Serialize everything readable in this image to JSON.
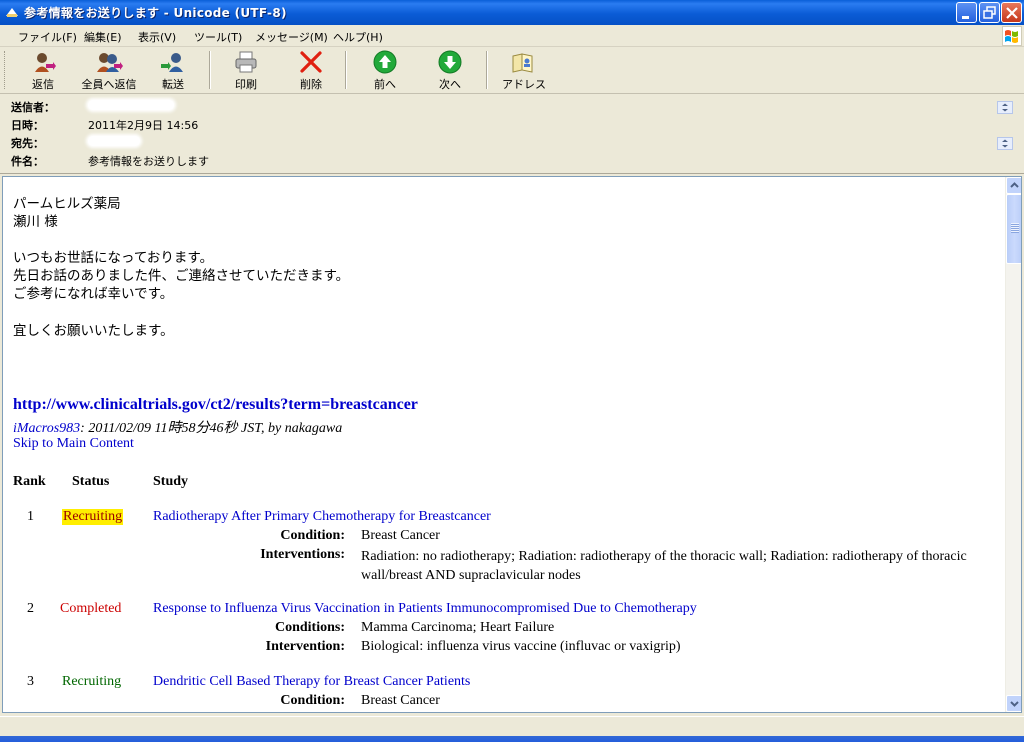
{
  "window": {
    "title": "参考情報をお送りします - Unicode (UTF-8)",
    "controls": [
      "minimize",
      "maximize",
      "close"
    ]
  },
  "menu": [
    {
      "label": "ファイル(F)"
    },
    {
      "label": "編集(E)"
    },
    {
      "label": "表示(V)"
    },
    {
      "label": "ツール(T)"
    },
    {
      "label": "メッセージ(M)"
    },
    {
      "label": "ヘルプ(H)"
    }
  ],
  "toolbar": {
    "reply": "返信",
    "reply_all": "全員へ返信",
    "forward": "転送",
    "print": "印刷",
    "delete": "削除",
    "previous": "前へ",
    "next": "次へ",
    "addresses": "アドレス"
  },
  "header": {
    "from_label": "送信者：",
    "date_label": "日時：",
    "date_value": "2011年2月9日 14:56",
    "to_label": "宛先：",
    "subject_label": "件名：",
    "subject_value": "参考情報をお送りします"
  },
  "message": {
    "lines": [
      "パームヒルズ薬局",
      "瀬川 様",
      "いつもお世話になっております。",
      "先日お話のありました件、ご連絡させていただきます。",
      "ご参考になれば幸いです。",
      "宜しくお願いいたします。"
    ],
    "url": "http://www.clinicaltrials.gov/ct2/results?term=breastcancer",
    "meta_link": "iMacros983",
    "meta_rest": ": 2011/02/09 11時58分46秒 JST, by nakagawa",
    "skip_link": "Skip to Main Content",
    "table_headers": {
      "rank": "Rank",
      "status": "Status",
      "study": "Study"
    },
    "results": [
      {
        "rank": "1",
        "status": "Recruiting",
        "title": "Radiotherapy After Primary Chemotherapy for Breastcancer",
        "field1_label": "Condition:",
        "field1_value": "Breast Cancer",
        "field2_label": "Interventions:",
        "field2_value": "Radiation: no radiotherapy; Radiation: radiotherapy of the thoracic wall; Radiation: radiotherapy of thoracic wall/breast AND supraclavicular nodes"
      },
      {
        "rank": "2",
        "status": "Completed",
        "title": "Response to Influenza Virus Vaccination in Patients Immunocompromised Due to Chemotherapy",
        "field1_label": "Conditions:",
        "field1_value": "Mamma Carcinoma; Heart Failure",
        "field2_label": "Intervention:",
        "field2_value": "Biological: influenza virus vaccine (influvac or vaxigrip)"
      },
      {
        "rank": "3",
        "status": "Recruiting",
        "title": "Dendritic Cell Based Therapy for Breast Cancer Patients",
        "field1_label": "Condition:",
        "field1_value": "Breast Cancer"
      }
    ]
  },
  "colors": {
    "recruiting_1_bg": "#ffee00",
    "recruiting_1_text": "#990000",
    "completed_text": "#cc0000",
    "recruiting_3_text": "#006600",
    "link": "#0000cc"
  }
}
